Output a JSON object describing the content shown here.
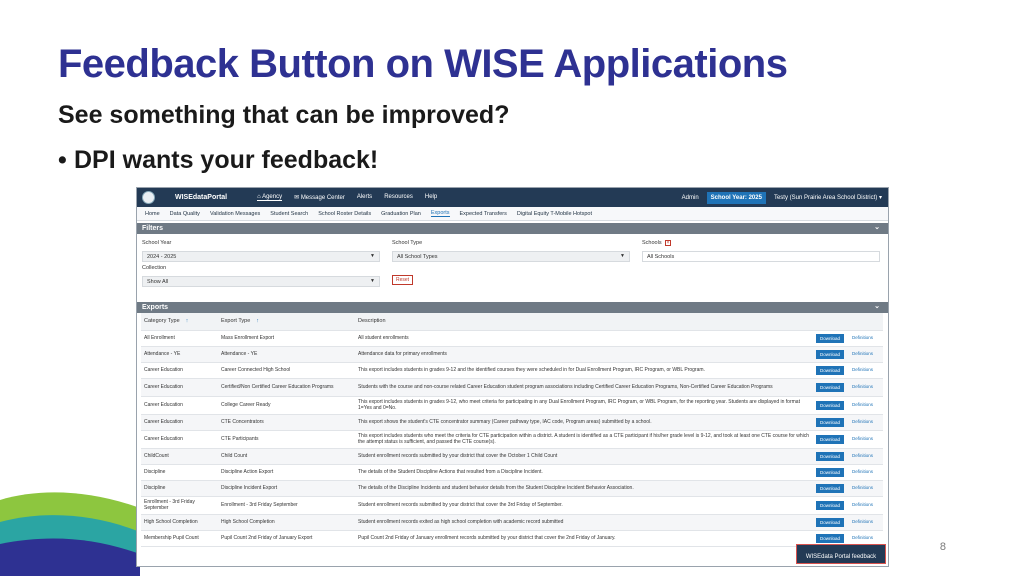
{
  "slide": {
    "title": "Feedback Button on WISE Applications",
    "subtitle": "See something that can be improved?",
    "bullet_mark": "•",
    "bullet": "DPI wants your feedback!",
    "page_number": "8"
  },
  "app": {
    "brand": "WISEdataPortal",
    "top_nav": [
      "Agency",
      "Message Center",
      "Alerts",
      "Resources",
      "Help"
    ],
    "top_right": {
      "admin": "Admin",
      "school_year": "School Year: 2025",
      "user": "Testy (Sun Prairie Area School District)"
    },
    "sub_nav": [
      "Home",
      "Data Quality",
      "Validation Messages",
      "Student Search",
      "School Roster Details",
      "Graduation Plan",
      "Exports",
      "Expected Transfers",
      "Digital Equity T-Mobile Hotspot"
    ],
    "active_sub_nav": "Exports",
    "filters": {
      "title": "Filters",
      "school_year_label": "School Year",
      "school_year_value": "2024 - 2025",
      "school_type_label": "School Type",
      "school_type_value": "All School Types",
      "schools_label": "Schools",
      "schools_value": "All Schools",
      "collection_label": "Collection",
      "collection_value": "Show All",
      "reset_label": "Reset"
    },
    "exports": {
      "title": "Exports",
      "columns": [
        "Category Type",
        "Export Type",
        "Description"
      ],
      "download_label": "Download",
      "definitions_label": "Definitions",
      "rows": [
        {
          "category": "All Enrollment",
          "type": "Mass Enrollment Export",
          "desc": "All student enrollments"
        },
        {
          "category": "Attendance - YE",
          "type": "Attendance - YE",
          "desc": "Attendance data for primary enrollments"
        },
        {
          "category": "Career Education",
          "type": "Career Connected High School",
          "desc": "This export includes students in grades 9-12 and the identified courses they were scheduled in for Dual Enrollment Program, IRC Program, or WBL Program."
        },
        {
          "category": "Career Education",
          "type": "Certified/Non Certified Career Education Programs",
          "desc": "Students with the course and non-course related Career Education student program associations including Certified Career Education Programs, Non-Certified Career Education Programs"
        },
        {
          "category": "Career Education",
          "type": "College Career Ready",
          "desc": "This export includes students in grades 9-12, who meet criteria for participating in any Dual Enrollment Program, IRC Program, or WBL Program, for the reporting year. Students are displayed in format 1=Yes and 0=No."
        },
        {
          "category": "Career Education",
          "type": "CTE Concentrators",
          "desc": "This export shows the student's CTE concentrator summary (Career pathway type, IAC code, Program areas) submitted by a school."
        },
        {
          "category": "Career Education",
          "type": "CTE Participants",
          "desc": "This export includes students who meet the criteria for CTE participation within a district. A student is identified as a CTE participant if his/her grade level is 9-12, and took at least one CTE course for which the attempt status is sufficient, and passed the CTE course(s)."
        },
        {
          "category": "ChildCount",
          "type": "Child Count",
          "desc": "Student enrollment records submitted by your district that cover the October 1 Child Count"
        },
        {
          "category": "Discipline",
          "type": "Discipline Action Export",
          "desc": "The details of the Student Discipline Actions that resulted from a Discipline Incident."
        },
        {
          "category": "Discipline",
          "type": "Discipline Incident Export",
          "desc": "The details of the Discipline Incidents and student behavior details from the Student Discipline Incident Behavior Association."
        },
        {
          "category": "Enrollment - 3rd Friday September",
          "type": "Enrollment - 3rd Friday September",
          "desc": "Student enrollment records submitted by your district that cover the 3rd Friday of September."
        },
        {
          "category": "High School Completion",
          "type": "High School Completion",
          "desc": "Student enrollment records exited as high school completion with academic record submitted"
        },
        {
          "category": "Membership Pupil Count",
          "type": "Pupil Count 2nd Friday of January Export",
          "desc": "Pupil Count 2nd Friday of January enrollment records submitted by your district that cover the 2nd Friday of January."
        }
      ]
    },
    "feedback_button": "WISEdata Portal feedback"
  },
  "colors": {
    "title": "#2e3192",
    "topbar": "#233a55",
    "accent": "#1f73b7",
    "feedback_border": "#d9534f"
  }
}
